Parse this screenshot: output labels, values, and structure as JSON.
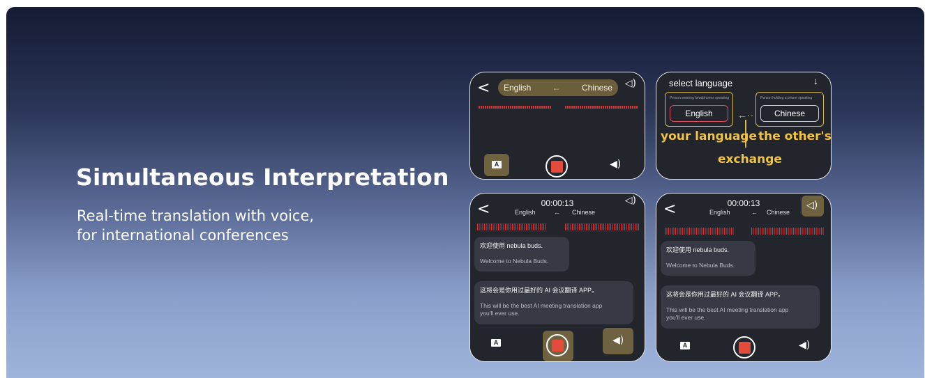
{
  "hero": {
    "title": "Simultaneous Interpretation",
    "subtitle_line1": "Real-time translation with voice,",
    "subtitle_line2": "for international conferences"
  },
  "screen1": {
    "source_lang": "English",
    "target_lang": "Chinese",
    "arrow": "←"
  },
  "screen2": {
    "title": "select language",
    "hint_left": "Person wearing headphones speaking",
    "hint_right": "Person holding a phone speaking",
    "left_lang": "English",
    "right_lang": "Chinese",
    "label_your": "your language",
    "label_other": "the other's",
    "label_exchange": "exchange"
  },
  "screen3": {
    "timer": "00:00:13",
    "source_lang": "English",
    "target_lang": "Chinese",
    "arrow": "←",
    "bubble1_zh": "欢迎使用 nebula buds.",
    "bubble1_en": "Welcome to Nebula Buds.",
    "bubble2_zh": "这将会是你用过最好的 AI 会议翻译 APP。",
    "bubble2_en_line1": "This will be the best AI meeting translation app",
    "bubble2_en_line2": "you'll ever use."
  },
  "screen4": {
    "timer": "00:00:13",
    "source_lang": "English",
    "target_lang": "Chinese",
    "arrow": "←",
    "bubble1_zh": "欢迎使用 nebula buds.",
    "bubble1_en": "Welcome to Nebula Buds.",
    "bubble2_zh": "这将会是你用过最好的 AI 会议翻译 APP。",
    "bubble2_en_line1": "This will be the best AI meeting translation app",
    "bubble2_en_line2": "you'll ever use."
  },
  "icons": {
    "back": "‹",
    "speaker": "🔈",
    "down_arrow": "↓",
    "a_glyph": "A"
  },
  "colors": {
    "gold": "#d8b94a",
    "label_yellow": "#f1c33e",
    "record_red": "#e54b3b",
    "wave_red": "#d1383a"
  }
}
